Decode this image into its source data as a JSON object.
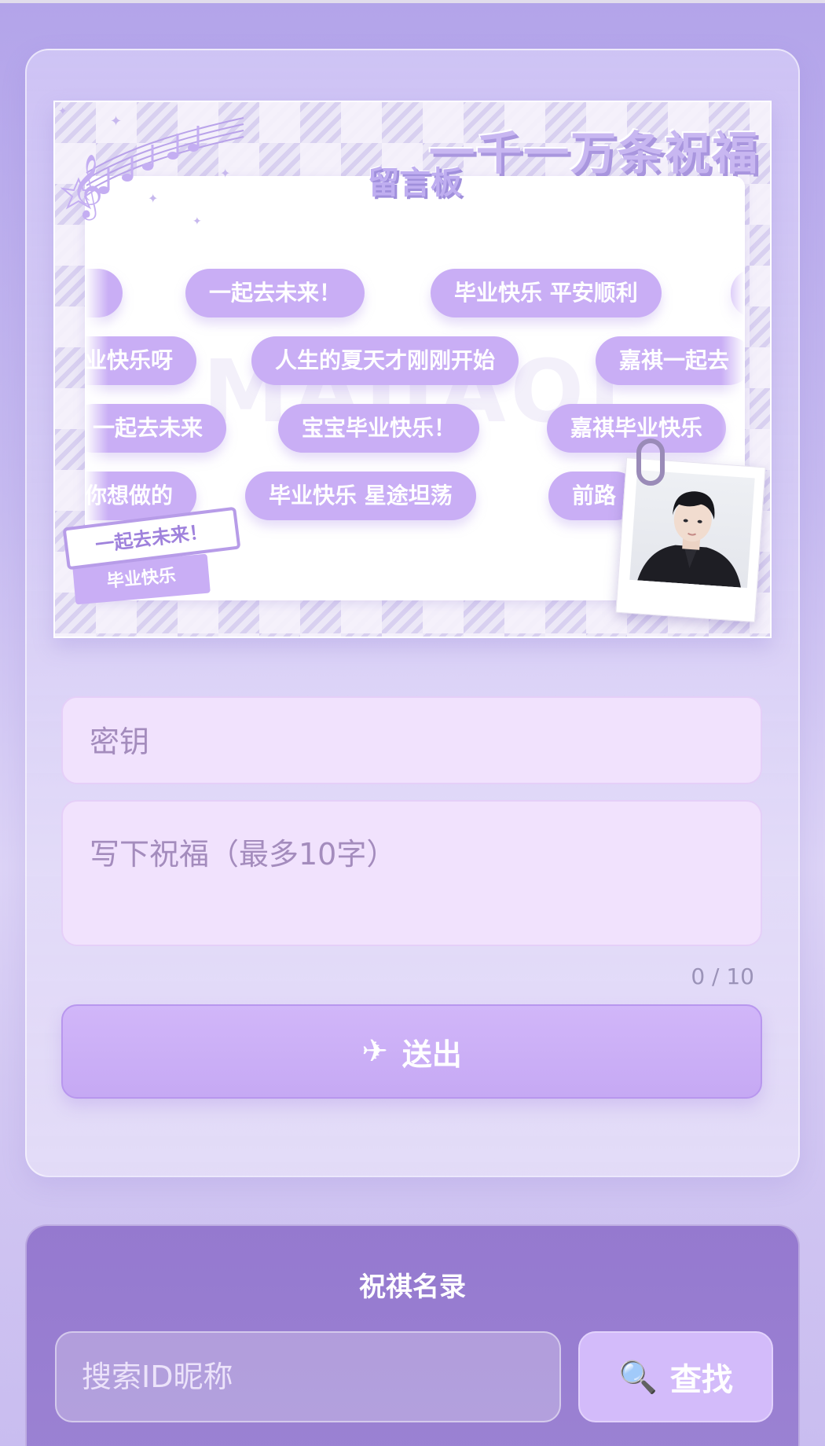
{
  "banner": {
    "title": "一千一万条祝福",
    "board_title": "留言板",
    "watermark": "MAJIAQI",
    "pills_row1": [
      "！",
      "一起去未来！",
      "毕业快乐 平安顺利",
      ""
    ],
    "pills_row2": [
      "业快乐呀",
      "人生的夏天才刚刚开始",
      "嘉祺一起去"
    ],
    "pills_row3": [
      "一起去未来",
      "宝宝毕业快乐！",
      "嘉祺毕业快乐"
    ],
    "pills_row4": [
      "你想做的",
      "毕业快乐 星途坦荡",
      "前路"
    ],
    "sticker_top": "一起去未来！",
    "sticker_bottom": "毕业快乐"
  },
  "form": {
    "key_placeholder": "密钥",
    "wish_placeholder": "写下祝福（最多10字）",
    "counter": "0 / 10",
    "send_icon": "✈",
    "send_label": "送出"
  },
  "roster": {
    "title": "祝祺名录",
    "search_placeholder": "搜索ID昵称",
    "search_icon": "🔍",
    "search_label": "查找"
  },
  "colors": {
    "accent": "#c9aef5",
    "background": "#b3a4ea",
    "roster_bg": "#9579cf"
  }
}
